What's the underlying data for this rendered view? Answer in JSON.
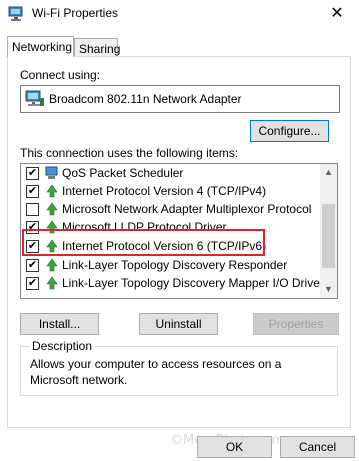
{
  "window": {
    "title": "Wi-Fi Properties",
    "close_glyph": "✕"
  },
  "tabs": [
    {
      "label": "Networking",
      "active": true
    },
    {
      "label": "Sharing",
      "active": false
    }
  ],
  "connect": {
    "label": "Connect using:",
    "adapter": "Broadcom 802.11n Network Adapter",
    "configure_label": "Configure..."
  },
  "items": {
    "label": "This connection uses the following items:",
    "rows": [
      {
        "label": "QoS Packet Scheduler",
        "checked": true,
        "icon": "qos-icon"
      },
      {
        "label": "Internet Protocol Version 4 (TCP/IPv4)",
        "checked": true,
        "icon": "protocol-icon"
      },
      {
        "label": "Microsoft Network Adapter Multiplexor Protocol",
        "checked": false,
        "icon": "protocol-icon"
      },
      {
        "label": "Microsoft LLDP Protocol Driver",
        "checked": true,
        "icon": "protocol-icon"
      },
      {
        "label": "Internet Protocol Version 6 (TCP/IPv6)",
        "checked": true,
        "icon": "protocol-icon"
      },
      {
        "label": "Link-Layer Topology Discovery Responder",
        "checked": true,
        "icon": "protocol-icon"
      },
      {
        "label": "Link-Layer Topology Discovery Mapper I/O Driver",
        "checked": true,
        "icon": "protocol-icon"
      }
    ],
    "highlight_color": "#d9272e"
  },
  "buttons": {
    "install": "Install...",
    "uninstall": "Uninstall",
    "properties": "Properties",
    "ok": "OK",
    "cancel": "Cancel"
  },
  "description": {
    "legend": "Description",
    "text": "Allows your computer to access resources on a Microsoft network."
  },
  "watermark": "©MeraBheja.com"
}
